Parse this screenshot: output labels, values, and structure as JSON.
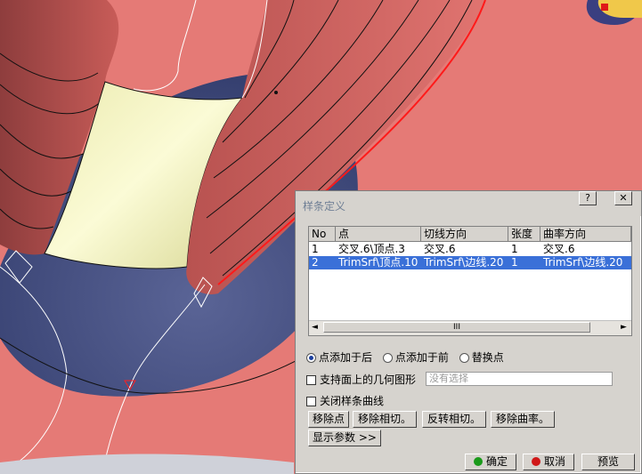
{
  "dialog": {
    "title": "样条定义",
    "help_glyph": "?",
    "close_glyph": "✕",
    "columns": [
      "No",
      "点",
      "切线方向",
      "张度",
      "曲率方向"
    ],
    "rows": [
      {
        "no": "1",
        "point": "交叉.6\\顶点.3",
        "tangent": "交叉.6",
        "tension": "1",
        "curvature": "交叉.6",
        "selected": false
      },
      {
        "no": "2",
        "point": "TrimSrf\\顶点.10",
        "tangent": "TrimSrf\\边线.20",
        "tension": "1",
        "curvature": "TrimSrf\\边线.20",
        "selected": true
      }
    ],
    "scroll_left": "◄",
    "scroll_right": "►",
    "scroll_thumb": "III",
    "radio_options": [
      {
        "label": "点添加于后",
        "checked": true
      },
      {
        "label": "点添加于前",
        "checked": false
      },
      {
        "label": "替换点",
        "checked": false
      }
    ],
    "support_label": "支持面上的几何图形",
    "support_placeholder": "没有选择",
    "close_spline_label": "关闭样条曲线",
    "buttons": {
      "remove_point": "移除点",
      "remove_tangent": "移除相切。",
      "reverse_tangent": "反转相切。",
      "remove_curvature": "移除曲率。",
      "show_params": "显示参数 >>",
      "ok": "确定",
      "cancel": "取消",
      "preview": "预览"
    }
  },
  "colors": {
    "surface": "#e57a76",
    "hole": "#404a7c",
    "fillet": "#f2f2b0",
    "accent_red": "#ff0000",
    "selection": "#3a70d8"
  }
}
